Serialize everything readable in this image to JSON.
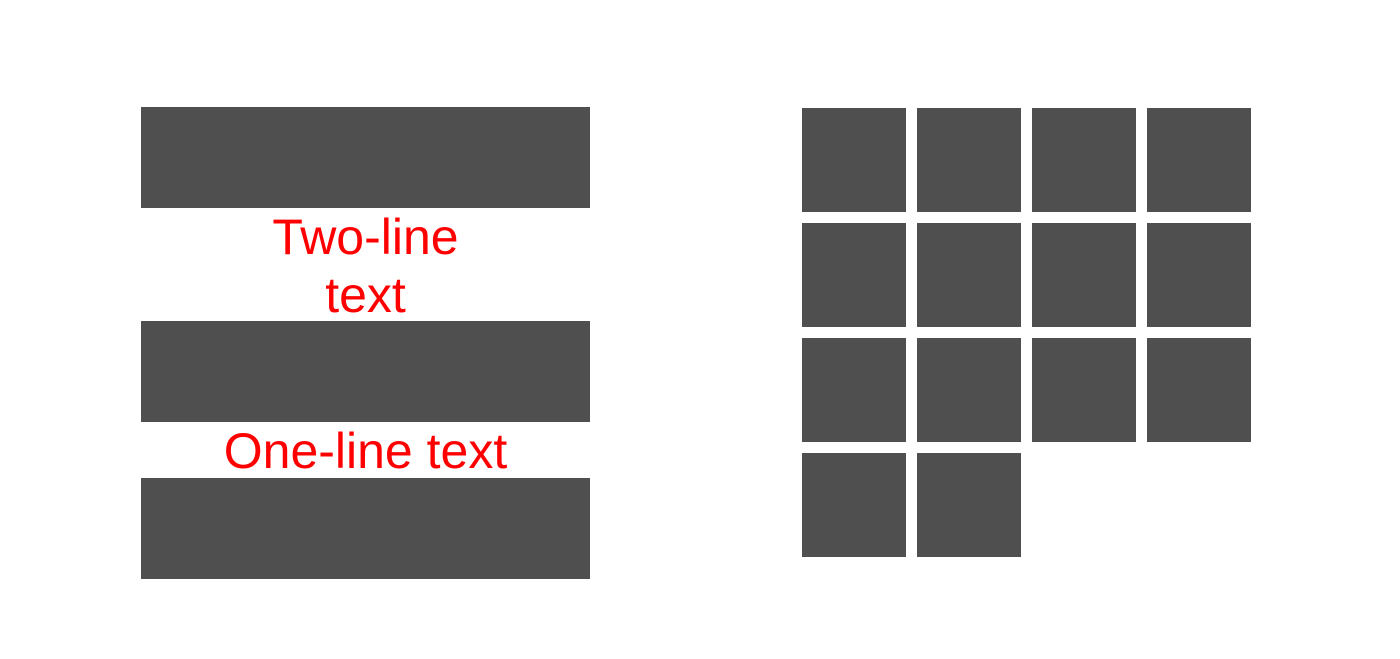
{
  "labels": {
    "two_line": [
      "Two-line",
      "text"
    ],
    "one_line": "One-line text"
  },
  "colors": {
    "block": "#4f4f4f",
    "label_text": "#ff0000",
    "background": "#ffffff"
  },
  "tile_grid": {
    "columns": 4,
    "tile_count": 14
  }
}
